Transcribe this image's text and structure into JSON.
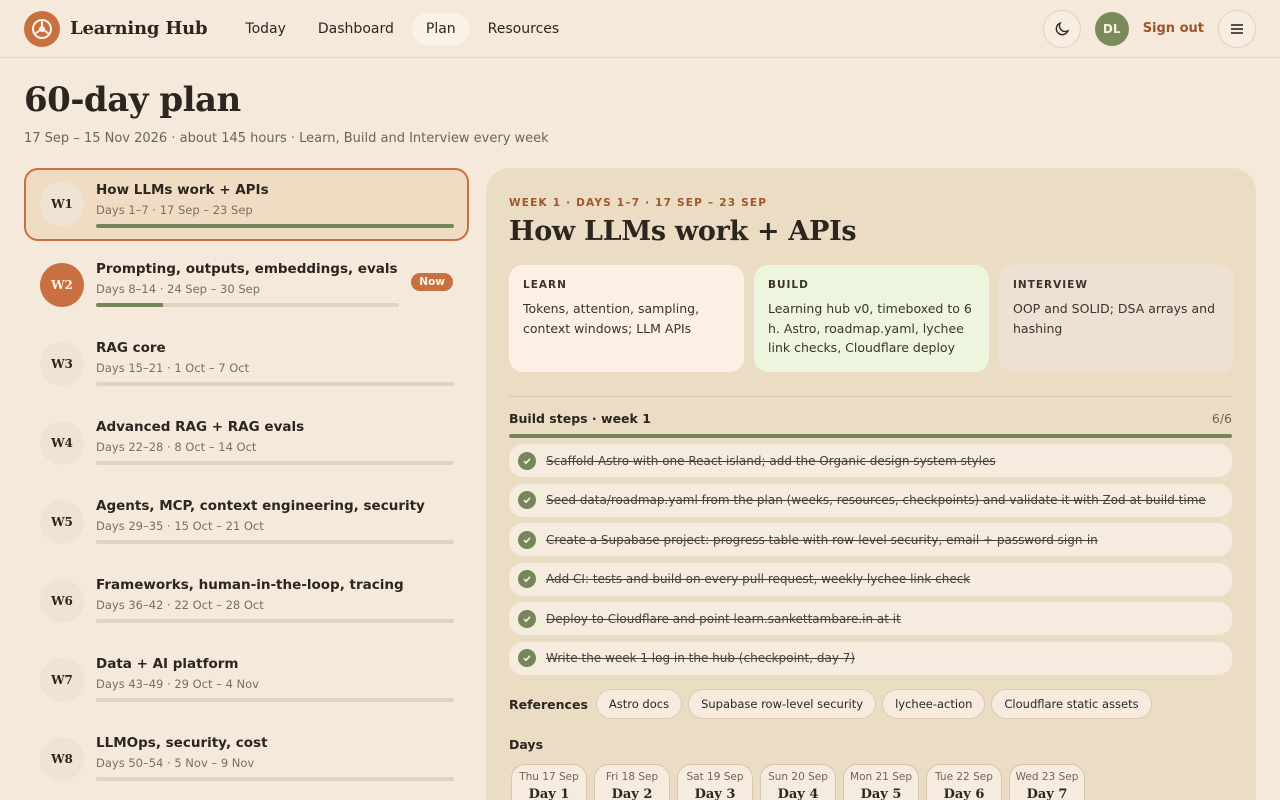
{
  "header": {
    "brand": "Learning Hub",
    "nav": [
      "Today",
      "Dashboard",
      "Plan",
      "Resources"
    ],
    "active_nav": "Plan",
    "avatar_initials": "DL",
    "signout": "Sign out",
    "icons": [
      "logo-icon",
      "moon-icon",
      "menu-icon"
    ]
  },
  "page": {
    "title": "60-day plan",
    "subtitle": "17 Sep – 15 Nov 2026 · about 145 hours · Learn, Build and Interview every week"
  },
  "weeks": [
    {
      "badge": "W1",
      "title": "How LLMs work + APIs",
      "meta": "Days 1–7 · 17 Sep – 23 Sep",
      "progress": 100
    },
    {
      "badge": "W2",
      "title": "Prompting, outputs, embeddings, evals",
      "meta": "Days 8–14 · 24 Sep – 30 Sep",
      "progress": 22,
      "tag": "Now"
    },
    {
      "badge": "W3",
      "title": "RAG core",
      "meta": "Days 15–21 · 1 Oct – 7 Oct",
      "progress": 0
    },
    {
      "badge": "W4",
      "title": "Advanced RAG + RAG evals",
      "meta": "Days 22–28 · 8 Oct – 14 Oct",
      "progress": 0
    },
    {
      "badge": "W5",
      "title": "Agents, MCP, context engineering, security",
      "meta": "Days 29–35 · 15 Oct – 21 Oct",
      "progress": 0
    },
    {
      "badge": "W6",
      "title": "Frameworks, human-in-the-loop, tracing",
      "meta": "Days 36–42 · 22 Oct – 28 Oct",
      "progress": 0
    },
    {
      "badge": "W7",
      "title": "Data + AI platform",
      "meta": "Days 43–49 · 29 Oct – 4 Nov",
      "progress": 0
    },
    {
      "badge": "W8",
      "title": "LLMOps, security, cost",
      "meta": "Days 50–54 · 5 Nov – 9 Nov",
      "progress": 0
    }
  ],
  "detail": {
    "eyebrow": "WEEK 1 · DAYS 1–7 · 17 SEP – 23 SEP",
    "title": "How LLMs work + APIs",
    "learn": {
      "label": "LEARN",
      "text": "Tokens, attention, sampling, context windows; LLM APIs"
    },
    "build": {
      "label": "BUILD",
      "text": "Learning hub v0, timeboxed to 6 h. Astro, roadmap.yaml, lychee link checks, Cloudflare deploy"
    },
    "interview": {
      "label": "INTERVIEW",
      "text": "OOP and SOLID; DSA arrays and hashing"
    },
    "steps_label": "Build steps · week 1",
    "steps_count": "6/6",
    "steps_progress": 100,
    "steps": [
      "Scaffold Astro with one React island; add the Organic design system styles",
      "Seed data/roadmap.yaml from the plan (weeks, resources, checkpoints) and validate it with Zod at build time",
      "Create a Supabase project: progress table with row-level security, email + password sign-in",
      "Add CI: tests and build on every pull request, weekly lychee link check",
      "Deploy to Cloudflare and point learn.sankettambare.in at it",
      "Write the week 1 log in the hub (checkpoint, day 7)"
    ],
    "refs_label": "References",
    "refs": [
      "Astro docs",
      "Supabase row-level security",
      "lychee-action",
      "Cloudflare static assets"
    ],
    "days_label": "Days",
    "days": [
      {
        "date": "Thu 17 Sep",
        "label": "Day 1"
      },
      {
        "date": "Fri 18 Sep",
        "label": "Day 2"
      },
      {
        "date": "Sat 19 Sep",
        "label": "Day 3"
      },
      {
        "date": "Sun 20 Sep",
        "label": "Day 4"
      },
      {
        "date": "Mon 21 Sep",
        "label": "Day 5"
      },
      {
        "date": "Tue 22 Sep",
        "label": "Day 6"
      },
      {
        "date": "Wed 23 Sep",
        "label": "Day 7"
      }
    ]
  },
  "colors": {
    "accent": "#c8703f",
    "progress": "#75875a",
    "background": "#f4e9da"
  }
}
